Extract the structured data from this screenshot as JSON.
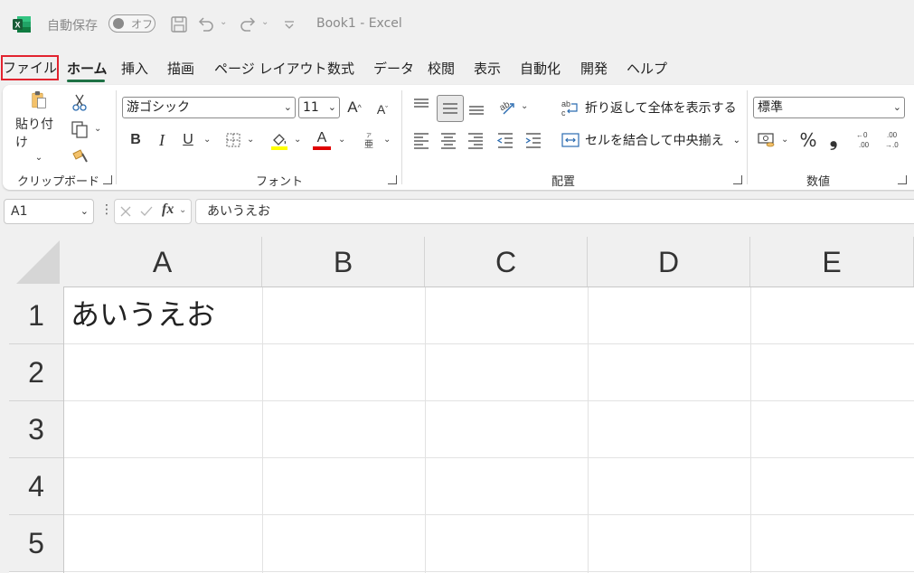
{
  "titlebar": {
    "autosave_label": "自動保存",
    "autosave_state": "オフ",
    "window_title": "Book1  -  Excel"
  },
  "tabs": [
    "ファイル",
    "ホーム",
    "挿入",
    "描画",
    "ページ レイアウト",
    "数式",
    "データ",
    "校閲",
    "表示",
    "自動化",
    "開発",
    "ヘルプ"
  ],
  "ribbon": {
    "clipboard": {
      "paste_label": "貼り付け",
      "group_label": "クリップボード"
    },
    "font": {
      "font_name": "游ゴシック",
      "font_size": "11",
      "group_label": "フォント",
      "bold": "B",
      "italic": "I",
      "underline": "U",
      "font_color_glyph": "A"
    },
    "alignment": {
      "wrap_text": "折り返して全体を表示する",
      "merge_center": "セルを結合して中央揃え",
      "group_label": "配置"
    },
    "number": {
      "format": "標準",
      "percent": "%",
      "comma": "❟",
      "group_label": "数値"
    }
  },
  "formula_bar": {
    "name_box": "A1",
    "fx": "fx",
    "content": "あいうえお"
  },
  "grid": {
    "columns": [
      "A",
      "B",
      "C",
      "D",
      "E"
    ],
    "rows": [
      "1",
      "2",
      "3",
      "4",
      "5"
    ],
    "cells": {
      "A1": "あいうえお"
    }
  },
  "colors": {
    "accent": "#1e7145",
    "highlight_box": "#e2232f",
    "fill_color": "#ffff00",
    "font_color": "#e00000"
  }
}
